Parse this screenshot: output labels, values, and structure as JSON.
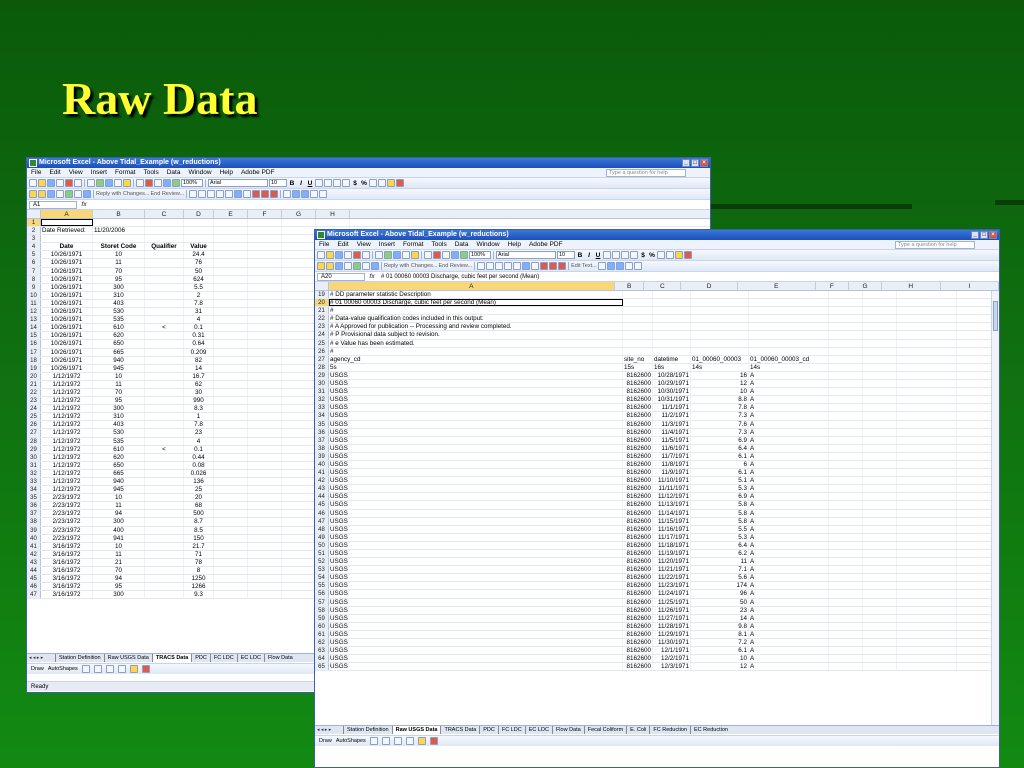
{
  "slide": {
    "title": "Raw Data"
  },
  "window1": {
    "title": "Microsoft Excel - Above Tidal_Example (w_reductions)",
    "menus": [
      "File",
      "Edit",
      "View",
      "Insert",
      "Format",
      "Tools",
      "Data",
      "Window",
      "Help",
      "Adobe PDF"
    ],
    "help_placeholder": "Type a question for help",
    "font_name": "Arial",
    "font_size": "10",
    "zoom": "100%",
    "reply_text": "Reply with Changes...",
    "end_review": "End Review...",
    "name_box": "A1",
    "formula": "",
    "columns": [
      "A",
      "B",
      "C",
      "D",
      "E",
      "F",
      "G",
      "H"
    ],
    "rows": [
      {
        "n": "1",
        "a": "",
        "b": "",
        "c": "",
        "d": ""
      },
      {
        "n": "2",
        "a": "Date Retrieved:",
        "b": "11/20/2006",
        "c": "",
        "d": ""
      },
      {
        "n": "3",
        "a": "",
        "b": "",
        "c": "",
        "d": ""
      },
      {
        "n": "4",
        "a": "Date",
        "b": "Storet Code",
        "c": "Qualifier",
        "d": "Value",
        "hdr": true
      },
      {
        "n": "5",
        "a": "10/26/1971",
        "b": "10",
        "c": "",
        "d": "24.4"
      },
      {
        "n": "6",
        "a": "10/26/1971",
        "b": "11",
        "c": "",
        "d": "76"
      },
      {
        "n": "7",
        "a": "10/26/1971",
        "b": "70",
        "c": "",
        "d": "50"
      },
      {
        "n": "8",
        "a": "10/26/1971",
        "b": "95",
        "c": "",
        "d": "624"
      },
      {
        "n": "9",
        "a": "10/26/1971",
        "b": "300",
        "c": "",
        "d": "5.5"
      },
      {
        "n": "10",
        "a": "10/26/1971",
        "b": "310",
        "c": "",
        "d": "2"
      },
      {
        "n": "11",
        "a": "10/26/1971",
        "b": "403",
        "c": "",
        "d": "7.8"
      },
      {
        "n": "12",
        "a": "10/26/1971",
        "b": "530",
        "c": "",
        "d": "31"
      },
      {
        "n": "13",
        "a": "10/26/1971",
        "b": "535",
        "c": "",
        "d": "4"
      },
      {
        "n": "14",
        "a": "10/26/1971",
        "b": "610",
        "c": "<",
        "d": "0.1"
      },
      {
        "n": "15",
        "a": "10/26/1971",
        "b": "620",
        "c": "",
        "d": "0.31"
      },
      {
        "n": "16",
        "a": "10/26/1971",
        "b": "650",
        "c": "",
        "d": "0.64"
      },
      {
        "n": "17",
        "a": "10/26/1971",
        "b": "665",
        "c": "",
        "d": "0.209"
      },
      {
        "n": "18",
        "a": "10/26/1971",
        "b": "940",
        "c": "",
        "d": "82"
      },
      {
        "n": "19",
        "a": "10/26/1971",
        "b": "945",
        "c": "",
        "d": "14"
      },
      {
        "n": "20",
        "a": "1/12/1972",
        "b": "10",
        "c": "",
        "d": "16.7"
      },
      {
        "n": "21",
        "a": "1/12/1972",
        "b": "11",
        "c": "",
        "d": "62"
      },
      {
        "n": "22",
        "a": "1/12/1972",
        "b": "70",
        "c": "",
        "d": "30"
      },
      {
        "n": "23",
        "a": "1/12/1972",
        "b": "95",
        "c": "",
        "d": "990"
      },
      {
        "n": "24",
        "a": "1/12/1972",
        "b": "300",
        "c": "",
        "d": "8.3"
      },
      {
        "n": "25",
        "a": "1/12/1972",
        "b": "310",
        "c": "",
        "d": "1"
      },
      {
        "n": "26",
        "a": "1/12/1972",
        "b": "403",
        "c": "",
        "d": "7.8"
      },
      {
        "n": "27",
        "a": "1/12/1972",
        "b": "530",
        "c": "",
        "d": "23"
      },
      {
        "n": "28",
        "a": "1/12/1972",
        "b": "535",
        "c": "",
        "d": "4"
      },
      {
        "n": "29",
        "a": "1/12/1972",
        "b": "610",
        "c": "<",
        "d": "0.1"
      },
      {
        "n": "30",
        "a": "1/12/1972",
        "b": "620",
        "c": "",
        "d": "0.44"
      },
      {
        "n": "31",
        "a": "1/12/1972",
        "b": "650",
        "c": "",
        "d": "0.08"
      },
      {
        "n": "32",
        "a": "1/12/1972",
        "b": "665",
        "c": "",
        "d": "0.026"
      },
      {
        "n": "33",
        "a": "1/12/1972",
        "b": "940",
        "c": "",
        "d": "136"
      },
      {
        "n": "34",
        "a": "1/12/1972",
        "b": "945",
        "c": "",
        "d": "25"
      },
      {
        "n": "35",
        "a": "2/23/1972",
        "b": "10",
        "c": "",
        "d": "20"
      },
      {
        "n": "36",
        "a": "2/23/1972",
        "b": "11",
        "c": "",
        "d": "68"
      },
      {
        "n": "37",
        "a": "2/23/1972",
        "b": "94",
        "c": "",
        "d": "500"
      },
      {
        "n": "38",
        "a": "2/23/1972",
        "b": "300",
        "c": "",
        "d": "8.7"
      },
      {
        "n": "39",
        "a": "2/23/1972",
        "b": "400",
        "c": "",
        "d": "8.5"
      },
      {
        "n": "40",
        "a": "2/23/1972",
        "b": "941",
        "c": "",
        "d": "150"
      },
      {
        "n": "41",
        "a": "3/16/1972",
        "b": "10",
        "c": "",
        "d": "21.7"
      },
      {
        "n": "42",
        "a": "3/16/1972",
        "b": "11",
        "c": "",
        "d": "71"
      },
      {
        "n": "43",
        "a": "3/16/1972",
        "b": "21",
        "c": "",
        "d": "78"
      },
      {
        "n": "44",
        "a": "3/16/1972",
        "b": "70",
        "c": "",
        "d": "8"
      },
      {
        "n": "45",
        "a": "3/16/1972",
        "b": "94",
        "c": "",
        "d": "1250"
      },
      {
        "n": "46",
        "a": "3/16/1972",
        "b": "95",
        "c": "",
        "d": "1266"
      },
      {
        "n": "47",
        "a": "3/16/1972",
        "b": "300",
        "c": "",
        "d": "9.3"
      }
    ],
    "tabs": [
      "Station Definition",
      "Raw USGS Data",
      "TRACS Data",
      "PDC",
      "FC LDC",
      "EC LDC",
      "Flow Data"
    ],
    "active_tab": "TRACS Data",
    "draw_label": "Draw",
    "autoshapes_label": "AutoShapes",
    "status": "Ready"
  },
  "window2": {
    "title": "Microsoft Excel - Above Tidal_Example (w_reductions)",
    "menus": [
      "File",
      "Edit",
      "View",
      "Insert",
      "Format",
      "Tools",
      "Data",
      "Window",
      "Help",
      "Adobe PDF"
    ],
    "help_placeholder": "Type a question for help",
    "font_name": "Arial",
    "font_size": "10",
    "zoom": "100%",
    "reply_text": "Reply with Changes...",
    "end_review": "End Review...",
    "edit_text": "Edit Text...",
    "name_box": "A20",
    "formula": "#   01   00060    00003    Discharge, cubic feet per second (Mean)",
    "columns": [
      "A",
      "B",
      "C",
      "D",
      "E",
      "F",
      "G",
      "H",
      "I"
    ],
    "comment_rows": [
      {
        "n": "19",
        "a": "#    DD parameter statistic   Description"
      },
      {
        "n": "20",
        "a": "#    01    00060      00003      Discharge, cubic feet per second (Mean)",
        "sel": true
      },
      {
        "n": "21",
        "a": "#"
      },
      {
        "n": "22",
        "a": "# Data-value qualification codes included in this output:"
      },
      {
        "n": "23",
        "a": "#     A  Approved for publication -- Processing and review completed."
      },
      {
        "n": "24",
        "a": "#     P  Provisional data subject to revision."
      },
      {
        "n": "25",
        "a": "#     e  Value has been estimated."
      },
      {
        "n": "26",
        "a": "#"
      }
    ],
    "header_rows": [
      {
        "n": "27",
        "a": "agency_cd",
        "b": "site_no",
        "c": "datetime",
        "d": "01_00060_00003",
        "e": "01_00060_00003_cd"
      },
      {
        "n": "28",
        "a": "5s",
        "b": "15s",
        "c": "16s",
        "d": "14s",
        "e": "14s"
      }
    ],
    "data_rows": [
      {
        "n": "29",
        "a": "USGS",
        "b": "8162600",
        "c": "10/28/1971",
        "d": "16",
        "e": "A"
      },
      {
        "n": "30",
        "a": "USGS",
        "b": "8162600",
        "c": "10/29/1971",
        "d": "12",
        "e": "A"
      },
      {
        "n": "31",
        "a": "USGS",
        "b": "8162600",
        "c": "10/30/1971",
        "d": "10",
        "e": "A"
      },
      {
        "n": "32",
        "a": "USGS",
        "b": "8162600",
        "c": "10/31/1971",
        "d": "8.8",
        "e": "A"
      },
      {
        "n": "33",
        "a": "USGS",
        "b": "8162600",
        "c": "11/1/1971",
        "d": "7.8",
        "e": "A"
      },
      {
        "n": "34",
        "a": "USGS",
        "b": "8162600",
        "c": "11/2/1971",
        "d": "7.3",
        "e": "A"
      },
      {
        "n": "35",
        "a": "USGS",
        "b": "8162600",
        "c": "11/3/1971",
        "d": "7.6",
        "e": "A"
      },
      {
        "n": "36",
        "a": "USGS",
        "b": "8162600",
        "c": "11/4/1971",
        "d": "7.3",
        "e": "A"
      },
      {
        "n": "37",
        "a": "USGS",
        "b": "8162600",
        "c": "11/5/1971",
        "d": "6.9",
        "e": "A"
      },
      {
        "n": "38",
        "a": "USGS",
        "b": "8162600",
        "c": "11/6/1971",
        "d": "6.4",
        "e": "A"
      },
      {
        "n": "39",
        "a": "USGS",
        "b": "8162600",
        "c": "11/7/1971",
        "d": "6.1",
        "e": "A"
      },
      {
        "n": "40",
        "a": "USGS",
        "b": "8162600",
        "c": "11/8/1971",
        "d": "6",
        "e": "A"
      },
      {
        "n": "41",
        "a": "USGS",
        "b": "8162600",
        "c": "11/9/1971",
        "d": "6.1",
        "e": "A"
      },
      {
        "n": "42",
        "a": "USGS",
        "b": "8162600",
        "c": "11/10/1971",
        "d": "5.1",
        "e": "A"
      },
      {
        "n": "43",
        "a": "USGS",
        "b": "8162600",
        "c": "11/11/1971",
        "d": "5.3",
        "e": "A"
      },
      {
        "n": "44",
        "a": "USGS",
        "b": "8162600",
        "c": "11/12/1971",
        "d": "6.9",
        "e": "A"
      },
      {
        "n": "45",
        "a": "USGS",
        "b": "8162600",
        "c": "11/13/1971",
        "d": "5.8",
        "e": "A"
      },
      {
        "n": "46",
        "a": "USGS",
        "b": "8162600",
        "c": "11/14/1971",
        "d": "5.8",
        "e": "A"
      },
      {
        "n": "47",
        "a": "USGS",
        "b": "8162600",
        "c": "11/15/1971",
        "d": "5.8",
        "e": "A"
      },
      {
        "n": "48",
        "a": "USGS",
        "b": "8162600",
        "c": "11/16/1971",
        "d": "5.5",
        "e": "A"
      },
      {
        "n": "49",
        "a": "USGS",
        "b": "8162600",
        "c": "11/17/1971",
        "d": "5.3",
        "e": "A"
      },
      {
        "n": "50",
        "a": "USGS",
        "b": "8162600",
        "c": "11/18/1971",
        "d": "6.4",
        "e": "A"
      },
      {
        "n": "51",
        "a": "USGS",
        "b": "8162600",
        "c": "11/19/1971",
        "d": "6.2",
        "e": "A"
      },
      {
        "n": "52",
        "a": "USGS",
        "b": "8162600",
        "c": "11/20/1971",
        "d": "11",
        "e": "A"
      },
      {
        "n": "53",
        "a": "USGS",
        "b": "8162600",
        "c": "11/21/1971",
        "d": "7.1",
        "e": "A"
      },
      {
        "n": "54",
        "a": "USGS",
        "b": "8162600",
        "c": "11/22/1971",
        "d": "5.6",
        "e": "A"
      },
      {
        "n": "55",
        "a": "USGS",
        "b": "8162600",
        "c": "11/23/1971",
        "d": "174",
        "e": "A"
      },
      {
        "n": "56",
        "a": "USGS",
        "b": "8162600",
        "c": "11/24/1971",
        "d": "96",
        "e": "A"
      },
      {
        "n": "57",
        "a": "USGS",
        "b": "8162600",
        "c": "11/25/1971",
        "d": "50",
        "e": "A"
      },
      {
        "n": "58",
        "a": "USGS",
        "b": "8162600",
        "c": "11/26/1971",
        "d": "23",
        "e": "A"
      },
      {
        "n": "59",
        "a": "USGS",
        "b": "8162600",
        "c": "11/27/1971",
        "d": "14",
        "e": "A"
      },
      {
        "n": "60",
        "a": "USGS",
        "b": "8162600",
        "c": "11/28/1971",
        "d": "9.8",
        "e": "A"
      },
      {
        "n": "61",
        "a": "USGS",
        "b": "8162600",
        "c": "11/29/1971",
        "d": "8.1",
        "e": "A"
      },
      {
        "n": "62",
        "a": "USGS",
        "b": "8162600",
        "c": "11/30/1971",
        "d": "7.2",
        "e": "A"
      },
      {
        "n": "63",
        "a": "USGS",
        "b": "8162600",
        "c": "12/1/1971",
        "d": "6.1",
        "e": "A"
      },
      {
        "n": "64",
        "a": "USGS",
        "b": "8162600",
        "c": "12/2/1971",
        "d": "10",
        "e": "A"
      },
      {
        "n": "65",
        "a": "USGS",
        "b": "8162600",
        "c": "12/3/1971",
        "d": "12",
        "e": "A"
      }
    ],
    "tabs": [
      "Station Definition",
      "Raw USGS Data",
      "TRACS Data",
      "PDC",
      "FC LDC",
      "EC LDC",
      "Flow Data",
      "Fecal Coliform",
      "E. Coli",
      "FC Reduction",
      "EC Reduction"
    ],
    "active_tab": "Raw USGS Data",
    "draw_label": "Draw",
    "autoshapes_label": "AutoShapes"
  }
}
